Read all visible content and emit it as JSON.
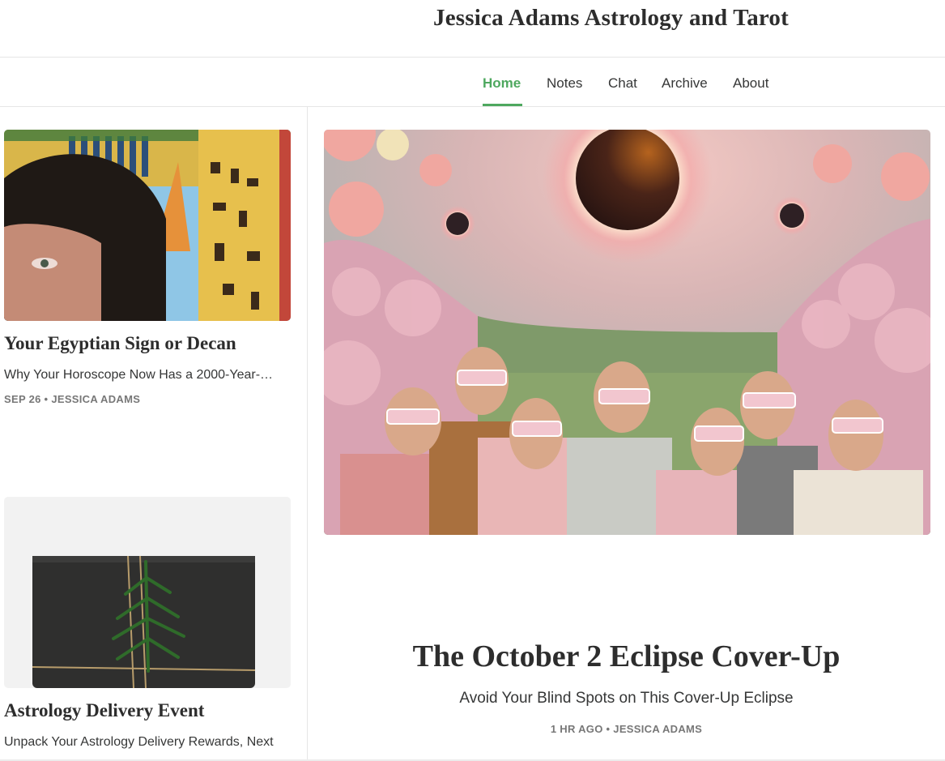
{
  "site": {
    "title": "Jessica Adams Astrology and Tarot"
  },
  "nav": {
    "items": [
      {
        "label": "Home",
        "active": true
      },
      {
        "label": "Notes"
      },
      {
        "label": "Chat"
      },
      {
        "label": "Archive"
      },
      {
        "label": "About"
      }
    ],
    "accent_color": "#4ea85f"
  },
  "posts": [
    {
      "title": "Your Egyptian Sign or Decan",
      "subtitle": "Why Your Horoscope Now Has a 2000-Year-…",
      "meta": "SEP 26 • JESSICA ADAMS",
      "image": "woman-with-egyptian-mural-photo"
    },
    {
      "title": "Astrology Delivery Event",
      "subtitle": "Unpack Your Astrology Delivery Rewards, Next",
      "image": "wrapped-gift-with-pine-sprig-photo"
    }
  ],
  "featured": {
    "title": "The October 2 Eclipse Cover-Up",
    "subtitle": "Avoid Your Blind Spots on This Cover-Up Eclipse",
    "meta": "1 HR AGO • JESSICA ADAMS",
    "image": "people-in-eclipse-glasses-in-apple-orchard-illustration"
  }
}
